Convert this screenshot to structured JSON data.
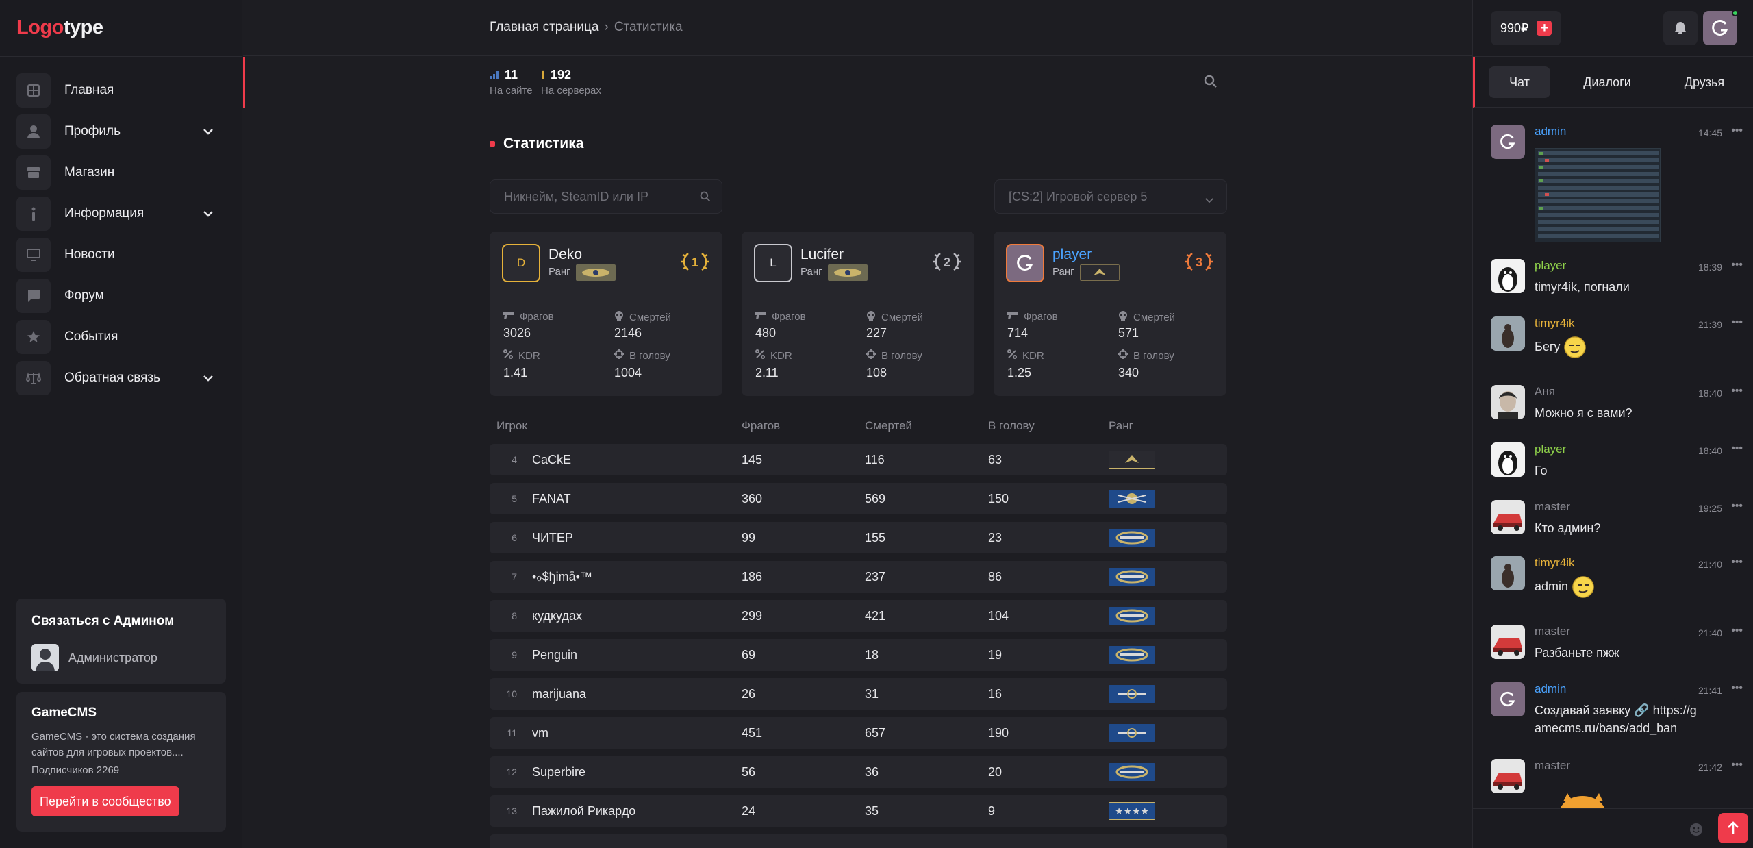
{
  "logo": {
    "part1": "Logo",
    "part2": "type"
  },
  "sidebar": {
    "items": [
      {
        "label": "Главная",
        "icon": "grid-icon"
      },
      {
        "label": "Профиль",
        "icon": "user-icon",
        "chevron": true
      },
      {
        "label": "Магазин",
        "icon": "shop-icon"
      },
      {
        "label": "Информация",
        "icon": "info-icon",
        "chevron": true
      },
      {
        "label": "Новости",
        "icon": "monitor-icon"
      },
      {
        "label": "Форум",
        "icon": "chat-icon"
      },
      {
        "label": "События",
        "icon": "star-icon"
      },
      {
        "label": "Обратная связь",
        "icon": "scales-icon",
        "chevron": true
      }
    ],
    "contact": {
      "title": "Связаться с Админом",
      "name": "Администратор"
    },
    "gamecms": {
      "title": "GameCMS",
      "desc": "GameCMS - это система создания сайтов для игровых проектов....",
      "subs": "Подписчиков 2269",
      "button": "Перейти в сообщество"
    }
  },
  "breadcrumb": {
    "home": "Главная страница",
    "sep": "›",
    "current": "Статистика"
  },
  "online": {
    "site": {
      "value": "11",
      "label": "На сайте"
    },
    "servers": {
      "value": "192",
      "label": "На серверах"
    }
  },
  "section_title": "Статистика",
  "search": {
    "placeholder": "Никнейм, SteamID или IP"
  },
  "server_select": {
    "value": "[CS:2] Игровой сервер 5"
  },
  "top_players": [
    {
      "initial": "D",
      "name": "Deko",
      "rank_label": "Ранг",
      "place": "1",
      "frags_label": "Фрагов",
      "frags": "3026",
      "deaths_label": "Смертей",
      "deaths": "2146",
      "kdr_label": "KDR",
      "kdr": "1.41",
      "hs_label": "В голову",
      "hs": "1004",
      "place_color": "#e6b23a"
    },
    {
      "initial": "L",
      "name": "Lucifer",
      "rank_label": "Ранг",
      "place": "2",
      "frags_label": "Фрагов",
      "frags": "480",
      "deaths_label": "Смертей",
      "deaths": "227",
      "kdr_label": "KDR",
      "kdr": "2.11",
      "hs_label": "В голову",
      "hs": "108",
      "place_color": "#b9b9c0"
    },
    {
      "initial": "",
      "name": "player",
      "rank_label": "Ранг",
      "place": "3",
      "frags_label": "Фрагов",
      "frags": "714",
      "deaths_label": "Смертей",
      "deaths": "571",
      "kdr_label": "KDR",
      "kdr": "1.25",
      "hs_label": "В голову",
      "hs": "340",
      "place_color": "#ef7a3b"
    }
  ],
  "table": {
    "headers": [
      "Игрок",
      "Фрагов",
      "Смертей",
      "В голову",
      "Ранг"
    ],
    "rows": [
      {
        "pos": "4",
        "name": "CaCkE",
        "frags": "145",
        "deaths": "116",
        "hs": "63"
      },
      {
        "pos": "5",
        "name": "FANAT",
        "frags": "360",
        "deaths": "569",
        "hs": "150"
      },
      {
        "pos": "6",
        "name": "ЧИТЕР",
        "frags": "99",
        "deaths": "155",
        "hs": "23"
      },
      {
        "pos": "7",
        "name": "•ℴ$ђimå•™",
        "frags": "186",
        "deaths": "237",
        "hs": "86"
      },
      {
        "pos": "8",
        "name": "кудкудах",
        "frags": "299",
        "deaths": "421",
        "hs": "104"
      },
      {
        "pos": "9",
        "name": "Penguin",
        "frags": "69",
        "deaths": "18",
        "hs": "19"
      },
      {
        "pos": "10",
        "name": "marijuana",
        "frags": "26",
        "deaths": "31",
        "hs": "16"
      },
      {
        "pos": "11",
        "name": "vm",
        "frags": "451",
        "deaths": "657",
        "hs": "190"
      },
      {
        "pos": "12",
        "name": "Superbire",
        "frags": "56",
        "deaths": "36",
        "hs": "20"
      },
      {
        "pos": "13",
        "name": "Пажилой Рикардо",
        "frags": "24",
        "deaths": "35",
        "hs": "9"
      }
    ]
  },
  "right": {
    "balance": "990₽",
    "tabs": [
      "Чат",
      "Диалоги",
      "Друзья"
    ],
    "messages": [
      {
        "author": "admin",
        "time": "14:45",
        "text": "",
        "kind": "admin"
      },
      {
        "author": "player",
        "time": "18:39",
        "text": "timyr4ik, погнали",
        "kind": "player"
      },
      {
        "author": "timyr4ik",
        "time": "21:39",
        "text": "Бегу",
        "kind": "timyr"
      },
      {
        "author": "Аня",
        "time": "18:40",
        "text": "Можно я с вами?",
        "kind": "gray"
      },
      {
        "author": "player",
        "time": "18:40",
        "text": "Го",
        "kind": "player"
      },
      {
        "author": "master",
        "time": "19:25",
        "text": "Кто админ?",
        "kind": "gray"
      },
      {
        "author": "timyr4ik",
        "time": "21:40",
        "text": "admin",
        "kind": "timyr"
      },
      {
        "author": "master",
        "time": "21:40",
        "text": "Разбаньте пжж",
        "kind": "gray"
      },
      {
        "author": "admin",
        "time": "21:41",
        "text": "Создавай заявку 🔗 https://gamecms.ru/bans/add_ban",
        "kind": "admin"
      },
      {
        "author": "master",
        "time": "21:42",
        "text": "",
        "kind": "gray"
      }
    ]
  },
  "colors": {
    "accent": "#ef3b4b",
    "bg": "#1d1d22",
    "card": "#26262c"
  }
}
